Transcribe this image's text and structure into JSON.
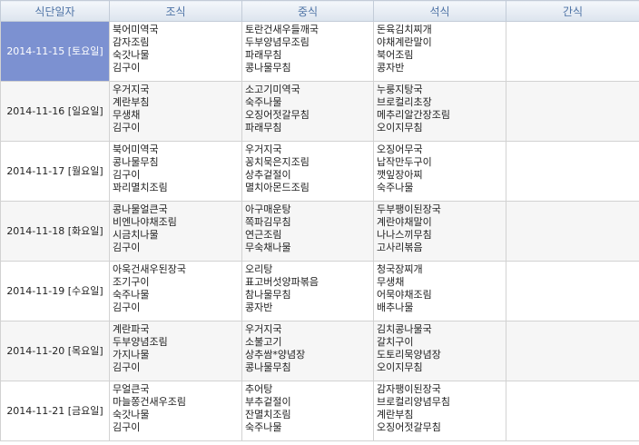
{
  "headers": [
    "식단일자",
    "조식",
    "중식",
    "석식",
    "간식"
  ],
  "days": [
    {
      "date": "2014-11-15 [토요일]",
      "selected": true,
      "breakfast": [
        "북어미역국",
        "감자조림",
        "숙갓나물",
        "김구이"
      ],
      "lunch": [
        "토란건새우들깨국",
        "두부양념무조림",
        "파래무침",
        "콩나물무침"
      ],
      "dinner": [
        "돈육김치찌개",
        "야채계란말이",
        "북어조림",
        "콩자반"
      ],
      "snack": []
    },
    {
      "date": "2014-11-16 [일요일]",
      "selected": false,
      "breakfast": [
        "우거지국",
        "계란부침",
        "무생채",
        "김구이"
      ],
      "lunch": [
        "소고기미역국",
        "숙주나물",
        "오징어젓갈무침",
        "파래무침"
      ],
      "dinner": [
        "누룽지탕국",
        "브로컬리초장",
        "메추리알간장조림",
        "오이지무침"
      ],
      "snack": []
    },
    {
      "date": "2014-11-17 [월요일]",
      "selected": false,
      "breakfast": [
        "북어미역국",
        "콩나물무침",
        "김구이",
        "꽈리멸치조림"
      ],
      "lunch": [
        "우거지국",
        "꽁치묵은지조림",
        "상추겉절이",
        "멸치아몬드조림"
      ],
      "dinner": [
        "오징어무국",
        "납작만두구이",
        "깻잎장아찌",
        "숙주나물"
      ],
      "snack": []
    },
    {
      "date": "2014-11-18 [화요일]",
      "selected": false,
      "breakfast": [
        "콩나물얼큰국",
        "비엔나야채조림",
        "시금치나물",
        "김구이"
      ],
      "lunch": [
        "아구매운탕",
        "쪽파김무침",
        "연근조림",
        "무숙채나물"
      ],
      "dinner": [
        "두부팽이된장국",
        "계란야채말이",
        "나나스끼무침",
        "고사리볶음"
      ],
      "snack": []
    },
    {
      "date": "2014-11-19 [수요일]",
      "selected": false,
      "breakfast": [
        "아욱건새우된장국",
        "조기구이",
        "숙주나물",
        "김구이"
      ],
      "lunch": [
        "오리탕",
        "표고버섯양파볶음",
        "참나물무침",
        "콩자반"
      ],
      "dinner": [
        "청국장찌개",
        "무생채",
        "어묵야채조림",
        "배추나물"
      ],
      "snack": []
    },
    {
      "date": "2014-11-20 [목요일]",
      "selected": false,
      "breakfast": [
        "계란파국",
        "두부양념조림",
        "가지나물",
        "김구이"
      ],
      "lunch": [
        "우거지국",
        "소불고기",
        "상추쌈*양념장",
        "콩나물무침"
      ],
      "dinner": [
        "김치콩나물국",
        "갈치구이",
        "도토리묵양념장",
        "오이지무침"
      ],
      "snack": []
    },
    {
      "date": "2014-11-21 [금요일]",
      "selected": false,
      "breakfast": [
        "무얼큰국",
        "마늘쫑건새우조림",
        "숙갓나물",
        "김구이"
      ],
      "lunch": [
        "추어탕",
        "부추겉절이",
        "잔멸치조림",
        "숙주나물"
      ],
      "dinner": [
        "감자팽이된장국",
        "브로컬리양념무침",
        "계란부침",
        "오징어젓갈무침"
      ],
      "snack": []
    }
  ]
}
